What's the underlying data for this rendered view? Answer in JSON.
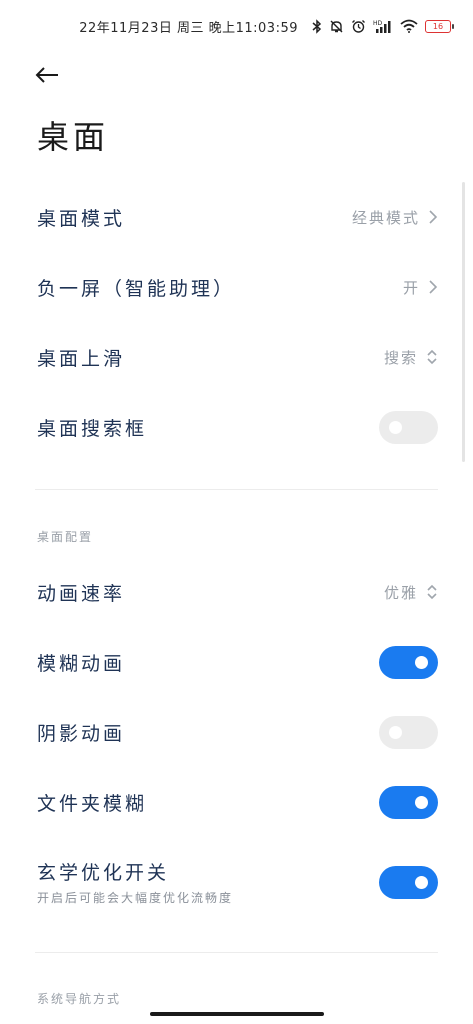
{
  "status_bar": {
    "time": "22年11月23日 周三 晚上11:03:59",
    "battery": "16"
  },
  "page": {
    "title": "桌面"
  },
  "rows": [
    {
      "label": "桌面模式",
      "value": "经典模式"
    },
    {
      "label": "负一屏（智能助理）",
      "value": "开"
    },
    {
      "label": "桌面上滑",
      "value": "搜索"
    },
    {
      "label": "桌面搜索框",
      "toggle": "off"
    }
  ],
  "section_config": {
    "title": "桌面配置",
    "rows": [
      {
        "label": "动画速率",
        "value": "优雅"
      },
      {
        "label": "模糊动画",
        "toggle": "on"
      },
      {
        "label": "阴影动画",
        "toggle": "off"
      },
      {
        "label": "文件夹模糊",
        "toggle": "on"
      },
      {
        "label": "玄学优化开关",
        "sub": "开启后可能会大幅度优化流畅度",
        "toggle": "on"
      }
    ]
  },
  "section_nav": {
    "title": "系统导航方式"
  },
  "colors": {
    "accent": "#1a7bf0",
    "toggle_off": "#ececec"
  }
}
